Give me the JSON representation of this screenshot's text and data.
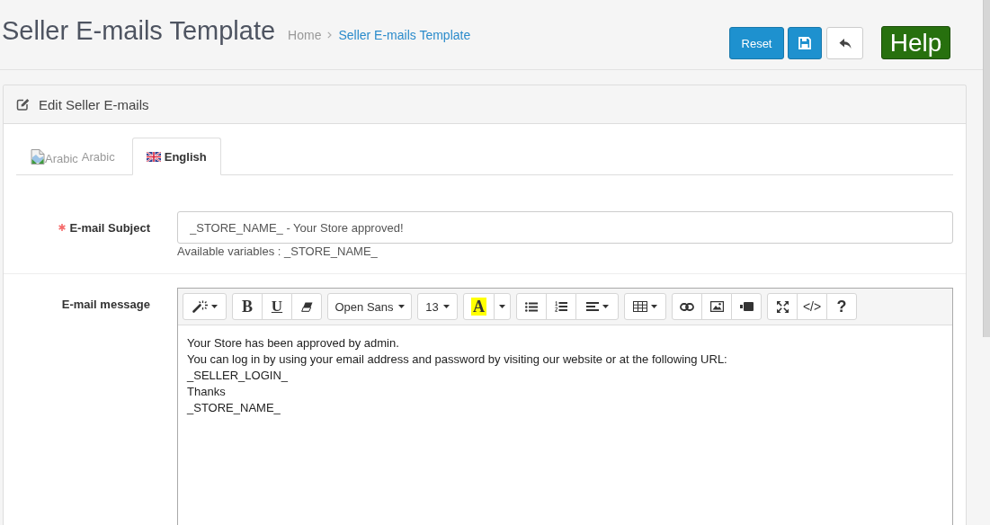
{
  "page_header": {
    "title": "Seller E-mails Template",
    "breadcrumb": [
      {
        "label": "Home"
      },
      {
        "label": "Seller E-mails Template"
      }
    ],
    "actions": [
      {
        "kind": "reset",
        "label": "Reset"
      },
      {
        "kind": "save"
      },
      {
        "kind": "back"
      },
      {
        "kind": "help",
        "label": "Help"
      }
    ]
  },
  "panel": {
    "title": "Edit Seller E-mails",
    "tabs": [
      {
        "kind": "broken-image",
        "image_alt": "Arabic",
        "label": "Arabic",
        "selected": false
      },
      {
        "kind": "flag",
        "label": "English",
        "selected": true
      }
    ],
    "fields": [
      {
        "kind": "text",
        "label": "E-mail Subject",
        "required": true,
        "value": "_STORE_NAME_ - Your Store approved!",
        "help": "Available variables : _STORE_NAME_"
      },
      {
        "kind": "editor",
        "label": "E-mail message",
        "required": false,
        "toolbar": [
          {
            "buttons": [
              {
                "kind": "style",
                "caret": true
              }
            ]
          },
          {
            "buttons": [
              {
                "kind": "bold",
                "label": "B"
              },
              {
                "kind": "underline",
                "label": "U"
              },
              {
                "kind": "clear"
              }
            ]
          },
          {
            "buttons": [
              {
                "kind": "fontname",
                "label": "Open Sans",
                "caret": true
              }
            ]
          },
          {
            "buttons": [
              {
                "kind": "fontsize",
                "label": "13",
                "caret": true
              }
            ]
          },
          {
            "buttons": [
              {
                "kind": "color",
                "label": "A"
              },
              {
                "kind": "more",
                "caret": true
              }
            ]
          },
          {
            "buttons": [
              {
                "kind": "ul"
              },
              {
                "kind": "ol"
              },
              {
                "kind": "paragraph",
                "caret": true
              }
            ]
          },
          {
            "buttons": [
              {
                "kind": "table",
                "caret": true
              }
            ]
          },
          {
            "buttons": [
              {
                "kind": "link"
              },
              {
                "kind": "picture"
              },
              {
                "kind": "video"
              }
            ]
          },
          {
            "buttons": [
              {
                "kind": "fullscreen"
              },
              {
                "kind": "codeview",
                "label": "</>"
              },
              {
                "kind": "help",
                "label": "?"
              }
            ]
          }
        ],
        "content": [
          "Your Store has been approved by admin.",
          "You can log in by using your email address and password by visiting our website or at the following URL:",
          "_SELLER_LOGIN_",
          "Thanks",
          "_STORE_NAME_"
        ]
      }
    ]
  }
}
